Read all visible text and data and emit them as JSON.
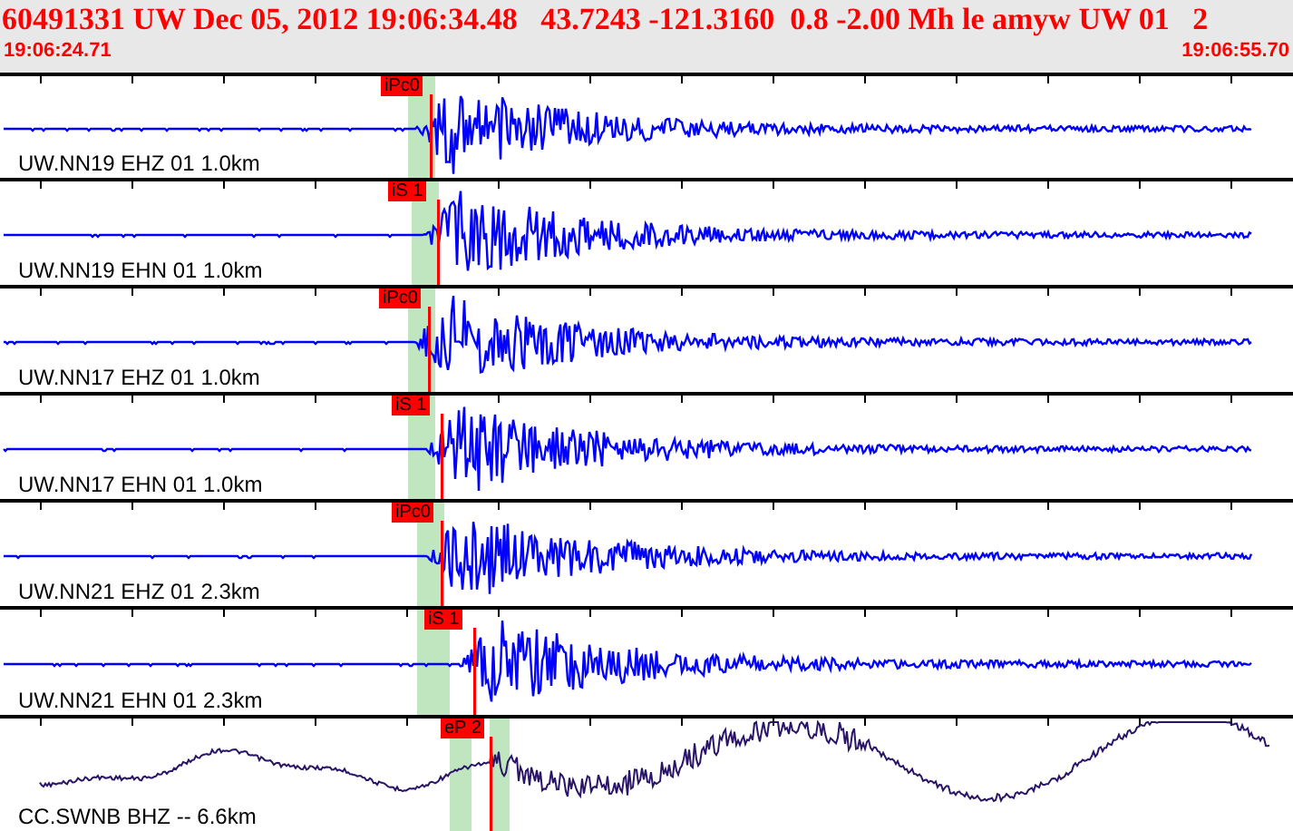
{
  "header": {
    "title": "60491331 UW Dec 05, 2012 19:06:34.48   43.7243 -121.3160  0.8 -2.00 Mh le amyw UW 01   2",
    "start_time": "19:06:24.71",
    "end_time": "19:06:55.70"
  },
  "traces": [
    {
      "station": "UW.NN19 EHZ 01 1.0km",
      "pick": "iPc0",
      "kind": "short"
    },
    {
      "station": "UW.NN19 EHN 01 1.0km",
      "pick": "iS 1",
      "kind": "short"
    },
    {
      "station": "UW.NN17 EHZ 01 1.0km",
      "pick": "iPc0",
      "kind": "short"
    },
    {
      "station": "UW.NN17 EHN 01 1.0km",
      "pick": "iS 1",
      "kind": "short"
    },
    {
      "station": "UW.NN21 EHZ 01 2.3km",
      "pick": "iPc0",
      "kind": "short"
    },
    {
      "station": "UW.NN21 EHN 01 2.3km",
      "pick": "iS 1",
      "kind": "short"
    },
    {
      "station": "CC.SWNB BHZ -- 6.6km",
      "pick": "eP 2",
      "kind": "broadband"
    }
  ]
}
